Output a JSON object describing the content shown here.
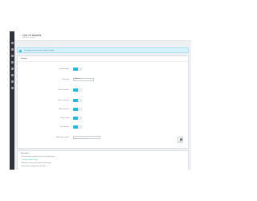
{
  "header": {
    "title": "List of assets",
    "subtitle": "Modules / Configure"
  },
  "alert": {
    "text": "This page is a preview of the module's settings"
  },
  "settings": {
    "title": "Settings",
    "fields": [
      {
        "label": "Enable module",
        "type": "toggle",
        "value": "YES"
      },
      {
        "label": "Asset type",
        "type": "select",
        "value": "All assets"
      },
      {
        "label": "Show on product",
        "type": "toggle",
        "value": "YES"
      },
      {
        "label": "Show in category",
        "type": "toggle",
        "value": "YES"
      },
      {
        "label": "Allow download",
        "type": "toggle",
        "value": "YES"
      },
      {
        "label": "Require login",
        "type": "toggle",
        "value": "YES"
      },
      {
        "label": "Show file size",
        "type": "toggle",
        "value": "YES"
      },
      {
        "label": "Allowed extensions",
        "type": "input",
        "value": "pdf, zip, doc, docx",
        "hint": "Separate values with commas"
      }
    ],
    "save_label": "Save"
  },
  "info_panel": {
    "title": "Information",
    "lines": [
      "To use this module, enable the asset list in the product page",
      "1. Configure module settings",
      "2. Add assets to your products from the product page",
      "3. Assets will be displayed on the front office"
    ]
  },
  "colors": {
    "accent": "#25b9d7",
    "sidebar": "#2f3339",
    "background": "#eef0f3"
  }
}
